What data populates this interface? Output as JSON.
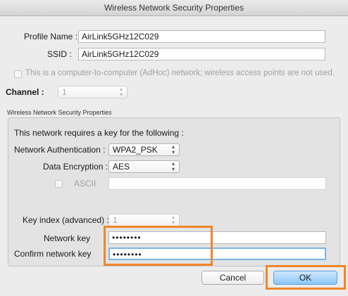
{
  "window": {
    "title": "Wireless Network Security Properties"
  },
  "profile": {
    "profile_name_label": "Profile Name :",
    "profile_name_value": "AirLink5GHz12C029",
    "ssid_label": "SSID :",
    "ssid_value": "AirLink5GHz12C029",
    "adhoc_label": "This is a computer-to-computer (AdHoc) network; wireless access points are not used.",
    "adhoc_checked": false,
    "channel_label": "Channel :",
    "channel_value": "1"
  },
  "security": {
    "section_title": "Wireless Network Security Properties",
    "requires_key_text": "This network requires a key for the following :",
    "auth_label": "Network Authentication :",
    "auth_value": "WPA2_PSK",
    "encryption_label": "Data Encryption :",
    "encryption_value": "AES",
    "ascii_label": "ASCII",
    "ascii_checked": false,
    "ascii_value": "",
    "key_index_label": "Key index (advanced) :",
    "key_index_value": "1",
    "network_key_label": "Network key",
    "network_key_value": "••••••••",
    "confirm_key_label": "Confirm network key",
    "confirm_key_value": "••••••••"
  },
  "buttons": {
    "cancel_label": "Cancel",
    "ok_label": "OK"
  },
  "colors": {
    "highlight": "#f0862a",
    "default_button": "#8cc6f7"
  }
}
